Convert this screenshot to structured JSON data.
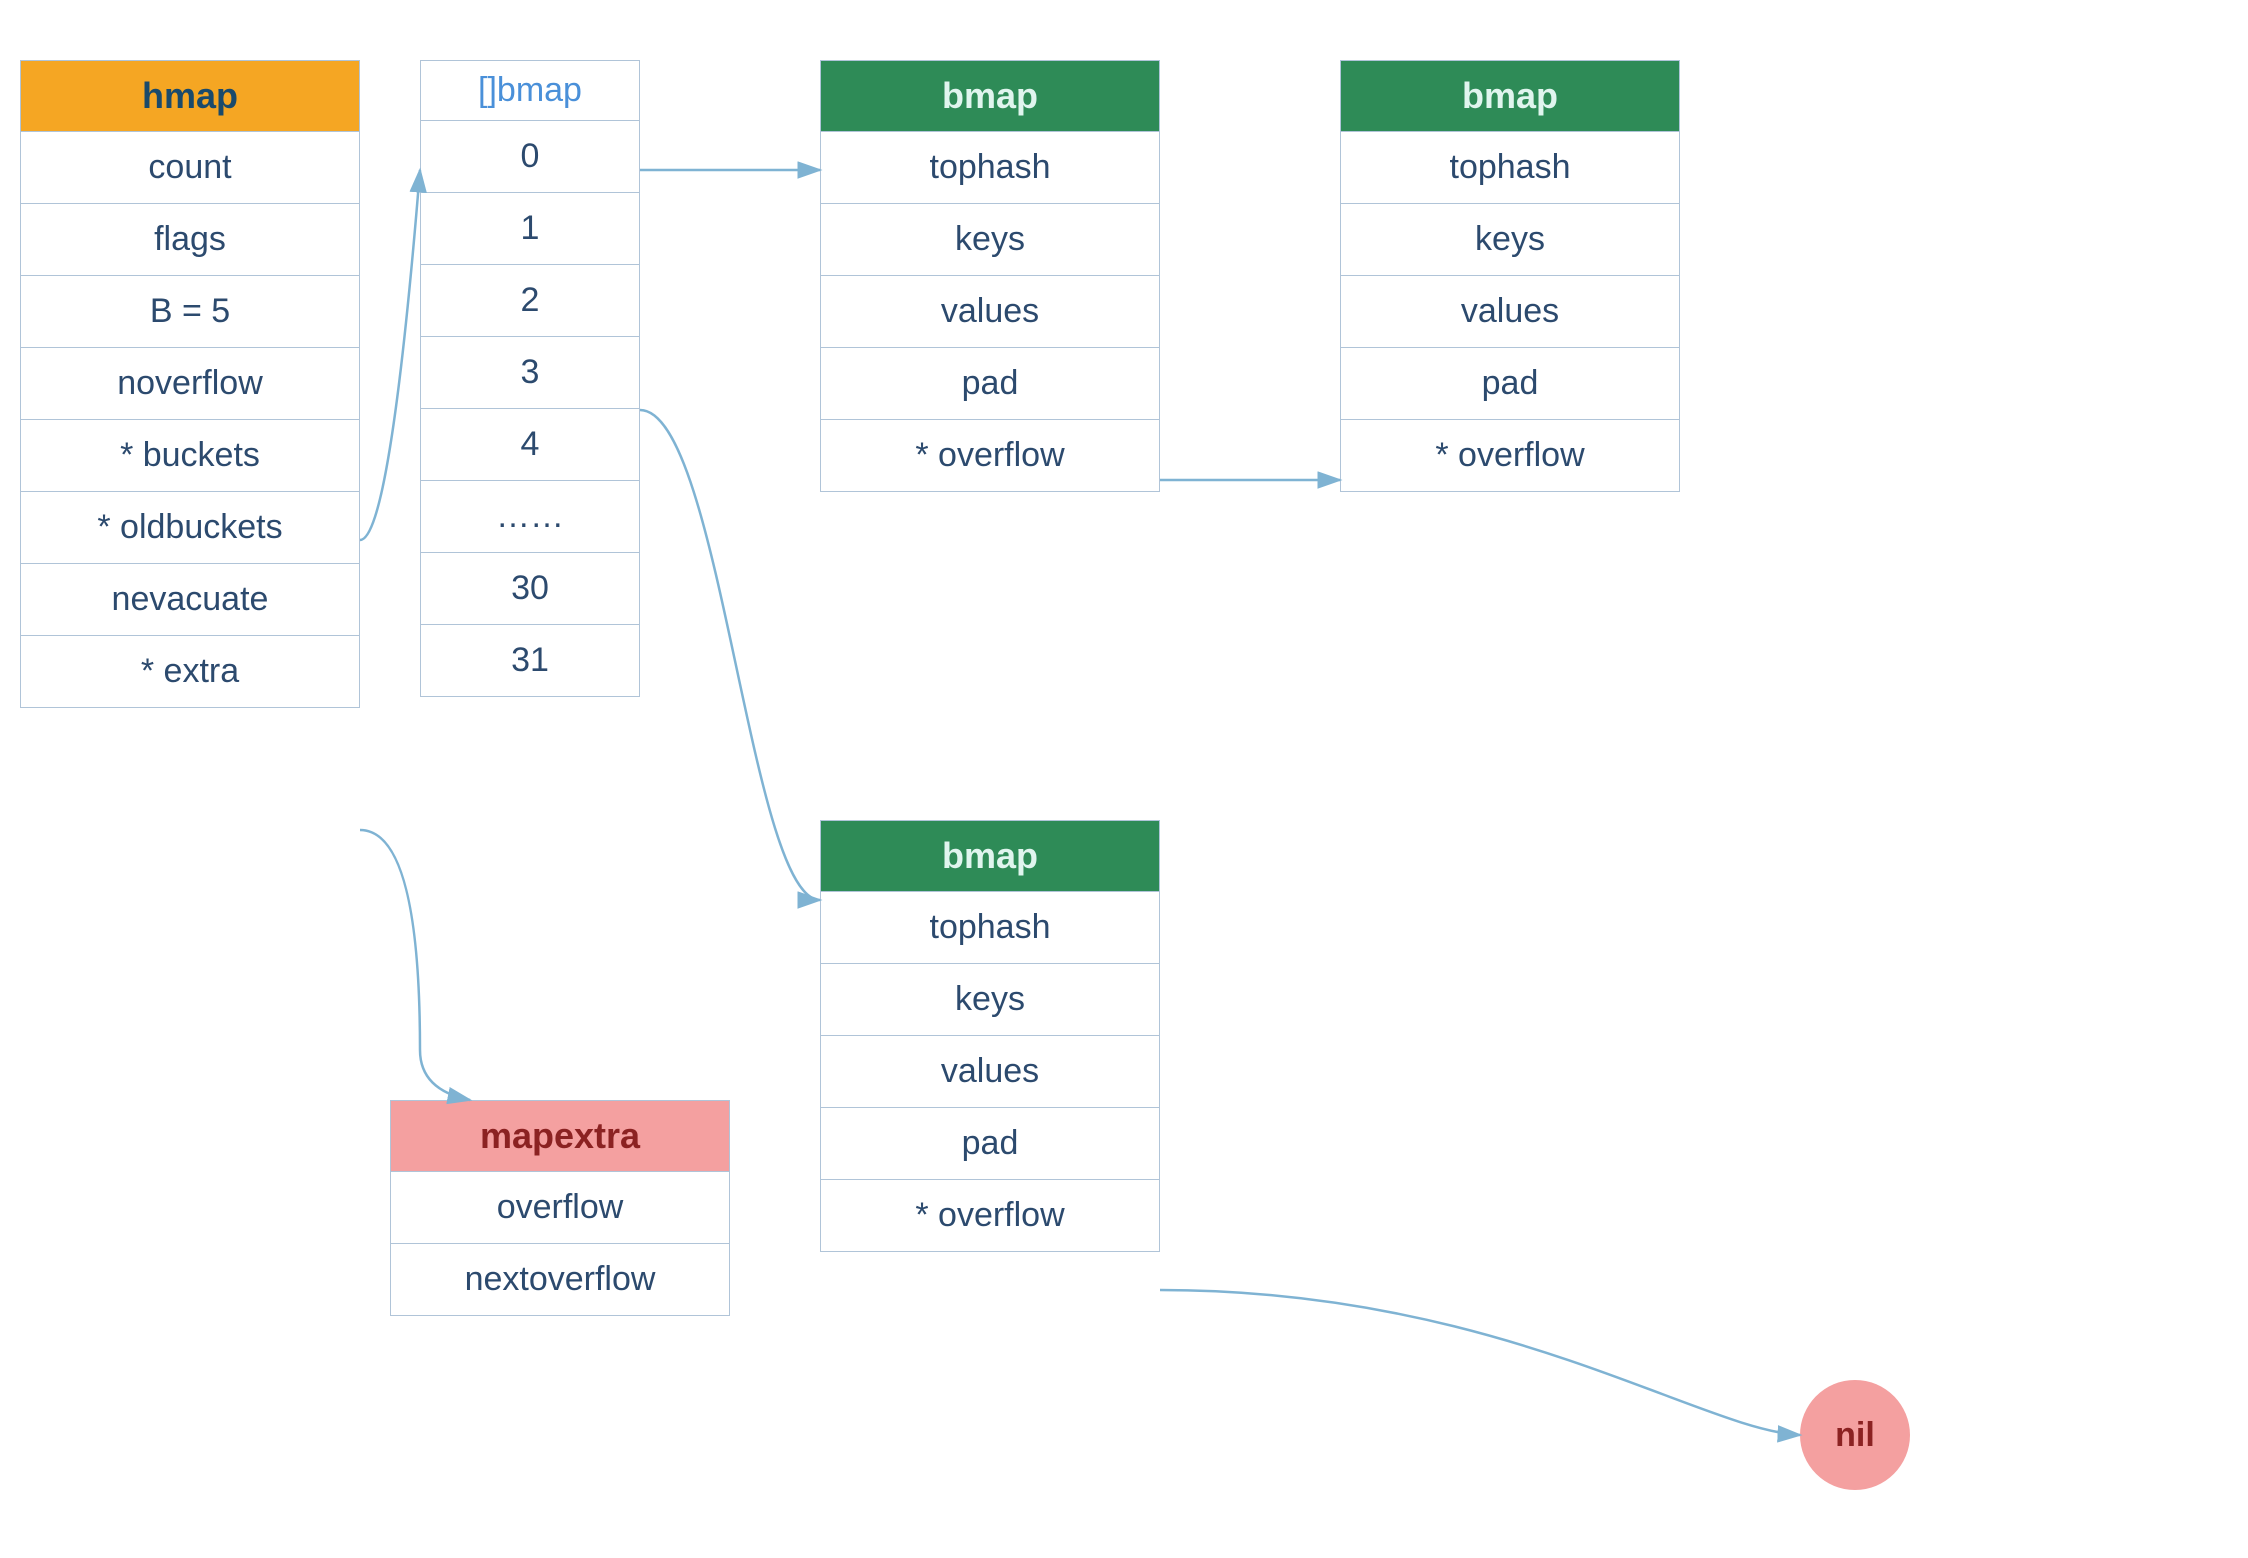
{
  "hmap": {
    "header": "hmap",
    "fields": [
      "count",
      "flags",
      "B = 5",
      "noverflow",
      "* buckets",
      "* oldbuckets",
      "nevacuate",
      "* extra"
    ]
  },
  "array": {
    "label": "[]bmap",
    "rows": [
      "0",
      "1",
      "2",
      "3",
      "4",
      "……",
      "30",
      "31"
    ]
  },
  "bmap1": {
    "header": "bmap",
    "fields": [
      "tophash",
      "keys",
      "values",
      "pad",
      "* overflow"
    ]
  },
  "bmap2": {
    "header": "bmap",
    "fields": [
      "tophash",
      "keys",
      "values",
      "pad",
      "* overflow"
    ]
  },
  "bmap3": {
    "header": "bmap",
    "fields": [
      "tophash",
      "keys",
      "values",
      "pad",
      "* overflow"
    ]
  },
  "mapextra": {
    "header": "mapextra",
    "fields": [
      "overflow",
      "nextoverflow"
    ]
  },
  "nil": "nil",
  "colors": {
    "orange": "#F5A623",
    "green": "#2E8B57",
    "pink": "#F4A0A0",
    "arrow": "#7fb3d3"
  }
}
